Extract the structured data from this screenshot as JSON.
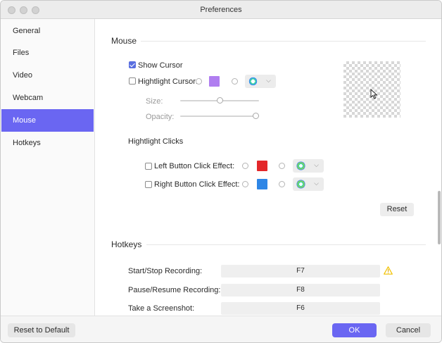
{
  "window": {
    "title": "Preferences"
  },
  "sidebar": {
    "items": [
      {
        "label": "General"
      },
      {
        "label": "Files"
      },
      {
        "label": "Video"
      },
      {
        "label": "Webcam"
      },
      {
        "label": "Mouse",
        "active": true
      },
      {
        "label": "Hotkeys"
      }
    ]
  },
  "mouse": {
    "heading": "Mouse",
    "show_cursor": {
      "label": "Show Cursor",
      "checked": true
    },
    "highlight_cursor": {
      "label": "Hightlight Cursor:",
      "checked": false,
      "color": "#b07ef0"
    },
    "size_label": "Size:",
    "size_value": 0.5,
    "opacity_label": "Opacity:",
    "opacity_value": 1.0,
    "highlight_clicks": {
      "heading": "Hightlight Clicks",
      "left": {
        "label": "Left Button Click Effect:",
        "checked": false,
        "color": "#e3272a"
      },
      "right": {
        "label": "Right Button Click Effect:",
        "checked": false,
        "color": "#2e86e6"
      }
    },
    "reset_label": "Reset"
  },
  "hotkeys": {
    "heading": "Hotkeys",
    "rows": [
      {
        "label": "Start/Stop Recording:",
        "key": "F7",
        "warning": true
      },
      {
        "label": "Pause/Resume Recording:",
        "key": "F8",
        "warning": false
      },
      {
        "label": "Take a Screenshot:",
        "key": "F6",
        "warning": false
      }
    ]
  },
  "footer": {
    "reset_default": "Reset to Default",
    "ok": "OK",
    "cancel": "Cancel"
  },
  "colors": {
    "accent": "#6a66f2",
    "warning": "#f2c200"
  },
  "icons": {
    "effect": "ring-effect-icon",
    "warning": "warning-triangle-icon",
    "cursor": "cursor-arrow-icon",
    "chevron": "chevron-down-icon"
  }
}
